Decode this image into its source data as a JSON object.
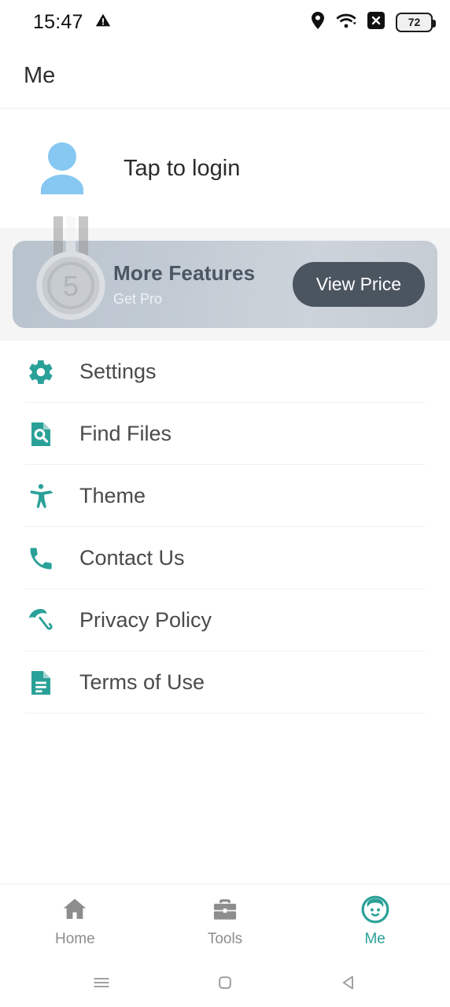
{
  "status_bar": {
    "time": "15:47",
    "warning_icon": "warning-triangle-icon",
    "location_icon": "location-pin-icon",
    "wifi_icon": "wifi-icon",
    "mute_icon": "x-badge-icon",
    "battery_level": "72"
  },
  "app_bar": {
    "title": "Me"
  },
  "account": {
    "avatar_icon": "person-avatar-icon",
    "login_label": "Tap to login",
    "avatar_color": "#86c8f2"
  },
  "promo": {
    "medal_icon": "medal-icon",
    "medal_number": "5",
    "title": "More Features",
    "subtitle": "Get Pro",
    "button_label": "View Price",
    "button_color": "#4b5560"
  },
  "menu": {
    "accent_color": "#2aa198",
    "items": [
      {
        "label": "Settings",
        "icon": "gear-icon"
      },
      {
        "label": "Find Files",
        "icon": "file-search-icon"
      },
      {
        "label": "Theme",
        "icon": "accessibility-person-icon"
      },
      {
        "label": "Contact Us",
        "icon": "phone-icon"
      },
      {
        "label": "Privacy Policy",
        "icon": "umbrella-icon"
      },
      {
        "label": "Terms of Use",
        "icon": "document-lines-icon"
      }
    ]
  },
  "tab_bar": {
    "active": "Me",
    "tabs": [
      {
        "label": "Home",
        "icon": "home-icon",
        "active": false
      },
      {
        "label": "Tools",
        "icon": "briefcase-icon",
        "active": false
      },
      {
        "label": "Me",
        "icon": "face-icon",
        "active": true
      }
    ]
  },
  "system_nav": {
    "recents_icon": "recents-menu-icon",
    "home_icon": "home-square-icon",
    "back_icon": "back-triangle-icon"
  }
}
